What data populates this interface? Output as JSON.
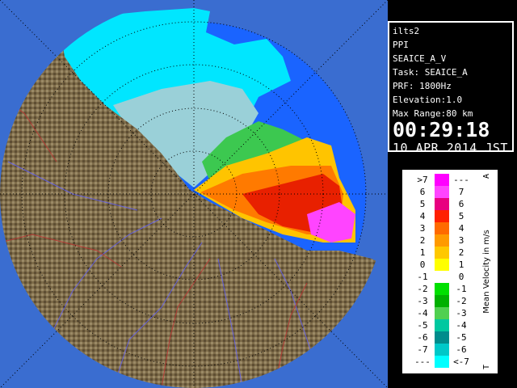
{
  "radar_info": {
    "site": "ilts2",
    "scan_type": "PPI",
    "product": "SEAICE_A_V",
    "task": "Task: SEAICE_A",
    "prf": "PRF: 1800Hz",
    "elevation": "Elevation:1.0",
    "max_range": "Max Range:80 km",
    "time": "00:29:18",
    "date": "10 APR 2014 JST"
  },
  "legend": {
    "title": "Mean Velocity in m/s",
    "top_letter": "A",
    "bottom_letter": "T",
    "rows": [
      {
        "left": ">7",
        "right": "---",
        "color": "#ff00ff"
      },
      {
        "left": "6",
        "right": "7",
        "color": "#ff44ff"
      },
      {
        "left": "5",
        "right": "6",
        "color": "#e80080"
      },
      {
        "left": "4",
        "right": "5",
        "color": "#ff2000"
      },
      {
        "left": "3",
        "right": "4",
        "color": "#ff6a00"
      },
      {
        "left": "2",
        "right": "3",
        "color": "#ff9a00"
      },
      {
        "left": "1",
        "right": "2",
        "color": "#ffc800"
      },
      {
        "left": "0",
        "right": "1",
        "color": "#ffff00"
      },
      {
        "left": "-1",
        "right": "0",
        "color": "#ffffff"
      },
      {
        "left": "-2",
        "right": "-1",
        "color": "#00e000"
      },
      {
        "left": "-3",
        "right": "-2",
        "color": "#00b000"
      },
      {
        "left": "-4",
        "right": "-3",
        "color": "#50d050"
      },
      {
        "left": "-5",
        "right": "-4",
        "color": "#00c8a0"
      },
      {
        "left": "-6",
        "right": "-5",
        "color": "#008c8c"
      },
      {
        "left": "-7",
        "right": "-6",
        "color": "#00c8c8"
      },
      {
        "left": "---",
        "right": "<-7",
        "color": "#00ffff"
      }
    ]
  },
  "colors": {
    "range_disc": "#1a64ff",
    "outside": "#3a6dd0",
    "land": "#7a6a4a",
    "sea_ice_cyan": "#00e0ff"
  }
}
